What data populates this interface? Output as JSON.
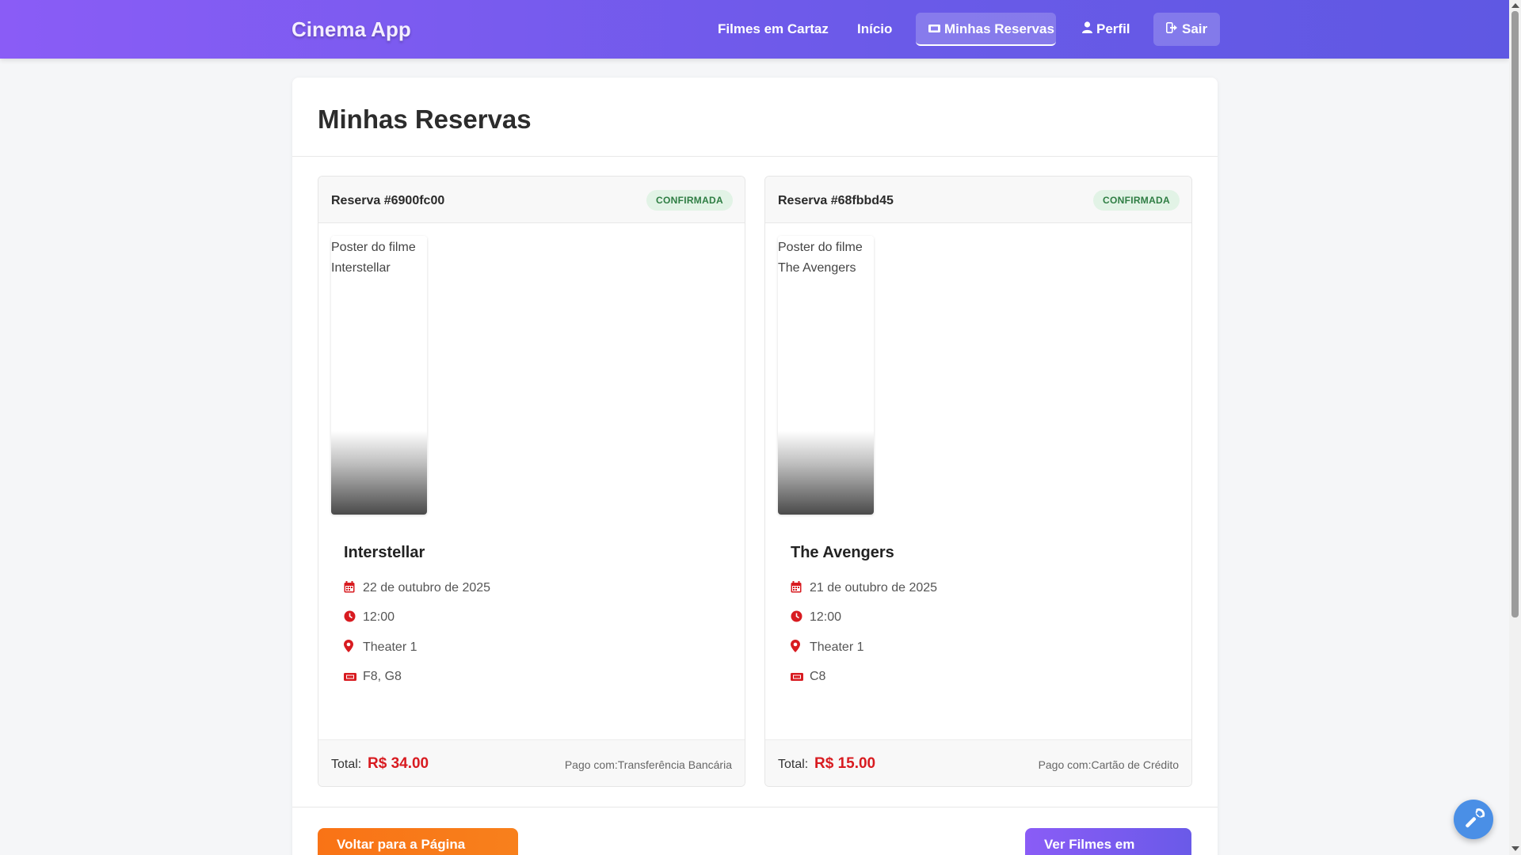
{
  "navbar": {
    "brand": "Cinema App",
    "items": [
      {
        "label": "Filmes em Cartaz",
        "icon": ""
      },
      {
        "label": "Início",
        "icon": ""
      },
      {
        "label": "Minhas Reservas",
        "icon": "ticket-icon",
        "active": true
      },
      {
        "label": "Perfil",
        "icon": "user-icon"
      },
      {
        "label": "Sair",
        "icon": "logout-icon"
      }
    ]
  },
  "page": {
    "title": "Minhas Reservas"
  },
  "reservations": [
    {
      "id_label": "Reserva #6900fc00",
      "status": "CONFIRMADA",
      "poster_alt": "Poster do filme Interstellar",
      "film": "Interstellar",
      "date": "22 de outubro de 2025",
      "time": "12:00",
      "room": "Theater 1",
      "seats": "F8, G8",
      "total_label": "Total:",
      "total": "R$ 34.00",
      "paid": "Pago com:Transferência Bancária"
    },
    {
      "id_label": "Reserva #68fbbd45",
      "status": "CONFIRMADA",
      "poster_alt": "Poster do filme The Avengers",
      "film": "The Avengers",
      "date": "21 de outubro de 2025",
      "time": "12:00",
      "room": "Theater 1",
      "seats": "C8",
      "total_label": "Total:",
      "total": "R$ 15.00",
      "paid": "Pago com:Cartão de Crédito"
    }
  ],
  "actions": {
    "home": "Voltar para a Página Inicial",
    "films": "Ver Filmes em Cartaz"
  },
  "colors": {
    "nav_gradient_start": "#8a5cf6",
    "nav_gradient_end": "#5f58e3",
    "status_bg": "#e2f3e6",
    "status_text": "#2e7d43",
    "price": "#d81b20",
    "icon": "#d81b20",
    "btn_home": "#f97316",
    "fab": "#4a8fe6"
  }
}
